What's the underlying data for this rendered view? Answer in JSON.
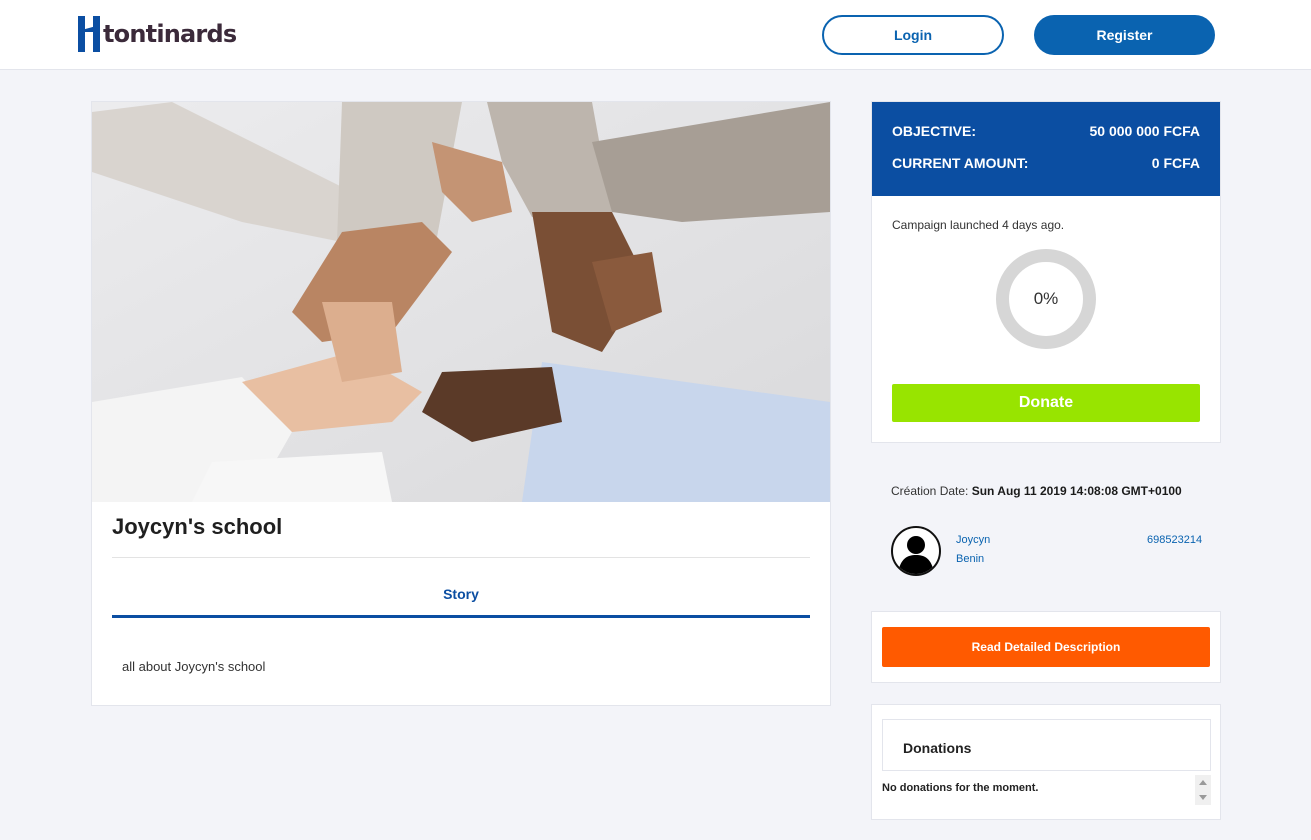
{
  "header": {
    "logo_text": "tontinards",
    "login_label": "Login",
    "register_label": "Register",
    "brand_color": "#0a63b0"
  },
  "campaign": {
    "title": "Joycyn's school",
    "tab_story_label": "Story",
    "story_text": "all about Joycyn's school",
    "hero_image": "people-joined-hands-photo"
  },
  "summary": {
    "objective_label": "OBJECTIVE:",
    "objective_value": "50 000 000 FCFA",
    "current_label": "CURRENT AMOUNT:",
    "current_value": "0 FCFA",
    "launched_text": "Campaign launched 4 days ago.",
    "progress_text": "0%",
    "progress_value": 0,
    "donate_label": "Donate",
    "donate_color": "#98e400",
    "header_color": "#0b4ea2"
  },
  "creator": {
    "creation_label": "Création Date:",
    "creation_value": "Sun Aug 11 2019 14:08:08 GMT+0100",
    "name": "Joycyn",
    "country": "Benin",
    "phone": "698523214",
    "avatar_icon": "user-silhouette-icon"
  },
  "actions": {
    "read_description_label": "Read Detailed Description",
    "read_color": "#ff5a00"
  },
  "donations": {
    "title": "Donations",
    "empty_text": "No donations for the moment."
  }
}
